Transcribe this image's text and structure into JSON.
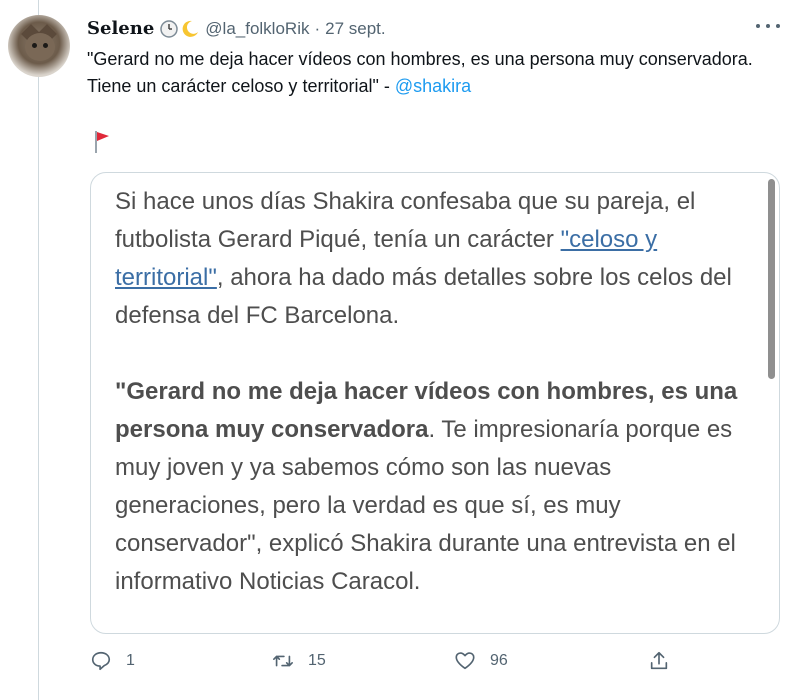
{
  "tweet": {
    "author": {
      "name": "Selene",
      "handle": "@la_folkloRik",
      "date": "27 sept."
    },
    "text_main": "\"Gerard no me deja hacer vídeos con hombres, es una persona muy conservadora. Tiene un carácter celoso y territorial\" - ",
    "mention": "@shakira",
    "icons": [
      "clock-emoji",
      "crescent-moon-emoji",
      "red-flag-emoji",
      "more-icon"
    ],
    "card": {
      "p1_a": "Si hace unos días Shakira confesaba que su pareja, el futbolista Gerard Piqué, tenía un carácter ",
      "p1_link": "\"celoso y territorial\"",
      "p1_b": ", ahora ha dado más detalles sobre los celos del defensa del FC Barcelona.",
      "p2_bold": "\"Gerard no me deja hacer vídeos con hombres, es una persona muy conservadora",
      "p2_rest": ". Te impresionaría porque es muy joven y ya sabemos cómo son las nuevas generaciones, pero la verdad es que sí, es muy conservador\", explicó Shakira durante una entrevista en el informativo Noticias Caracol."
    },
    "actions": {
      "replies": "1",
      "retweets": "15",
      "likes": "96"
    },
    "colors": {
      "accent": "#1d9bf0",
      "secondary_text": "#536471",
      "card_link": "#3b6ea5"
    }
  }
}
